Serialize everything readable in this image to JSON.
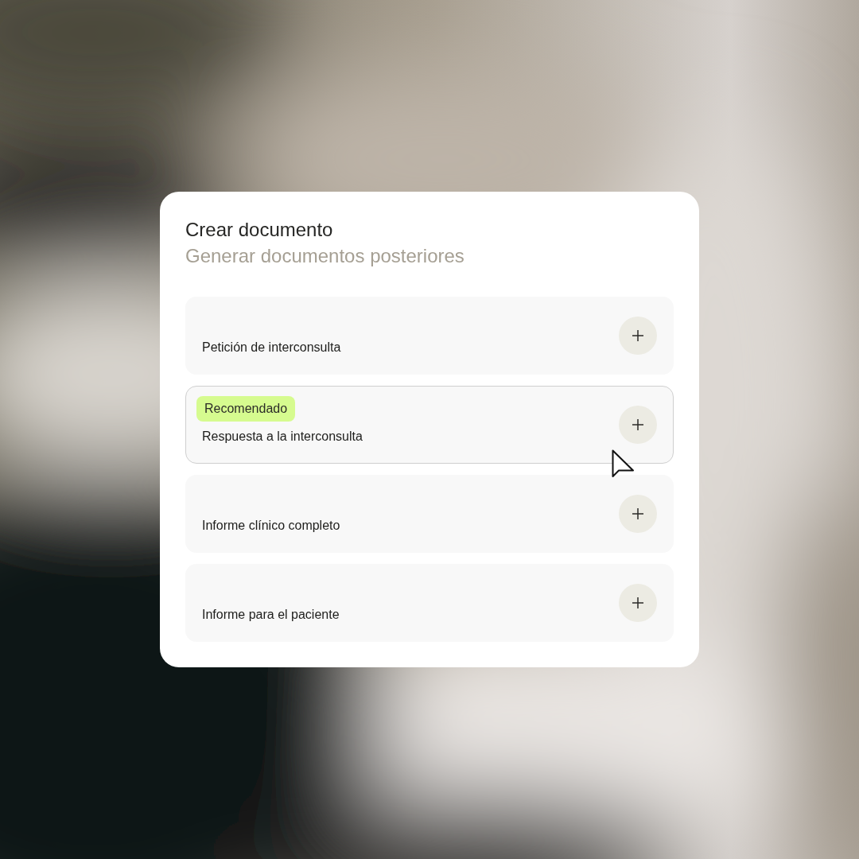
{
  "card": {
    "title": "Crear documento",
    "subtitle": "Generar documentos posteriores"
  },
  "documents": [
    {
      "label": "Petición de interconsulta",
      "highlighted": false
    },
    {
      "label": "Respuesta a la interconsulta",
      "badge": "Recomendado",
      "highlighted": true
    },
    {
      "label": "Informe clínico completo",
      "highlighted": false
    },
    {
      "label": "Informe para el paciente",
      "highlighted": false
    }
  ],
  "cursor": {
    "visible": true
  }
}
